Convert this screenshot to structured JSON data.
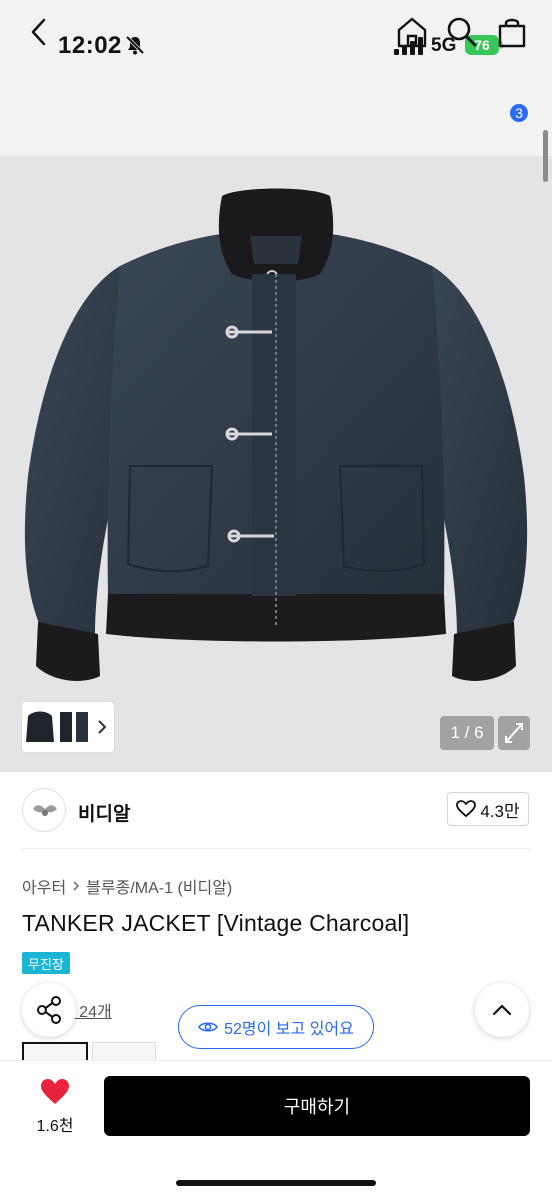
{
  "status_bar": {
    "time": "12:02",
    "network": "5G",
    "battery": "76"
  },
  "nav": {
    "cart_count": "3"
  },
  "gallery": {
    "page_counter": "1 / 6"
  },
  "brand": {
    "name": "비디알",
    "likes": "4.3만"
  },
  "breadcrumb": {
    "level1": "아우터",
    "level2": "블루종/MA-1 (비디알)"
  },
  "product": {
    "title": "TANKER JACKET [Vintage Charcoal]",
    "tag": "무진장",
    "review_link": "기 24개"
  },
  "viewing": {
    "text": "52명이 보고 있어요"
  },
  "bottom": {
    "wish_count": "1.6천",
    "buy_label": "구매하기"
  },
  "colors": {
    "accent_blue": "#2a6af5",
    "tag_cyan": "#1ab6d4",
    "heart_red": "#e8233b",
    "jacket": "#2f3a47"
  }
}
